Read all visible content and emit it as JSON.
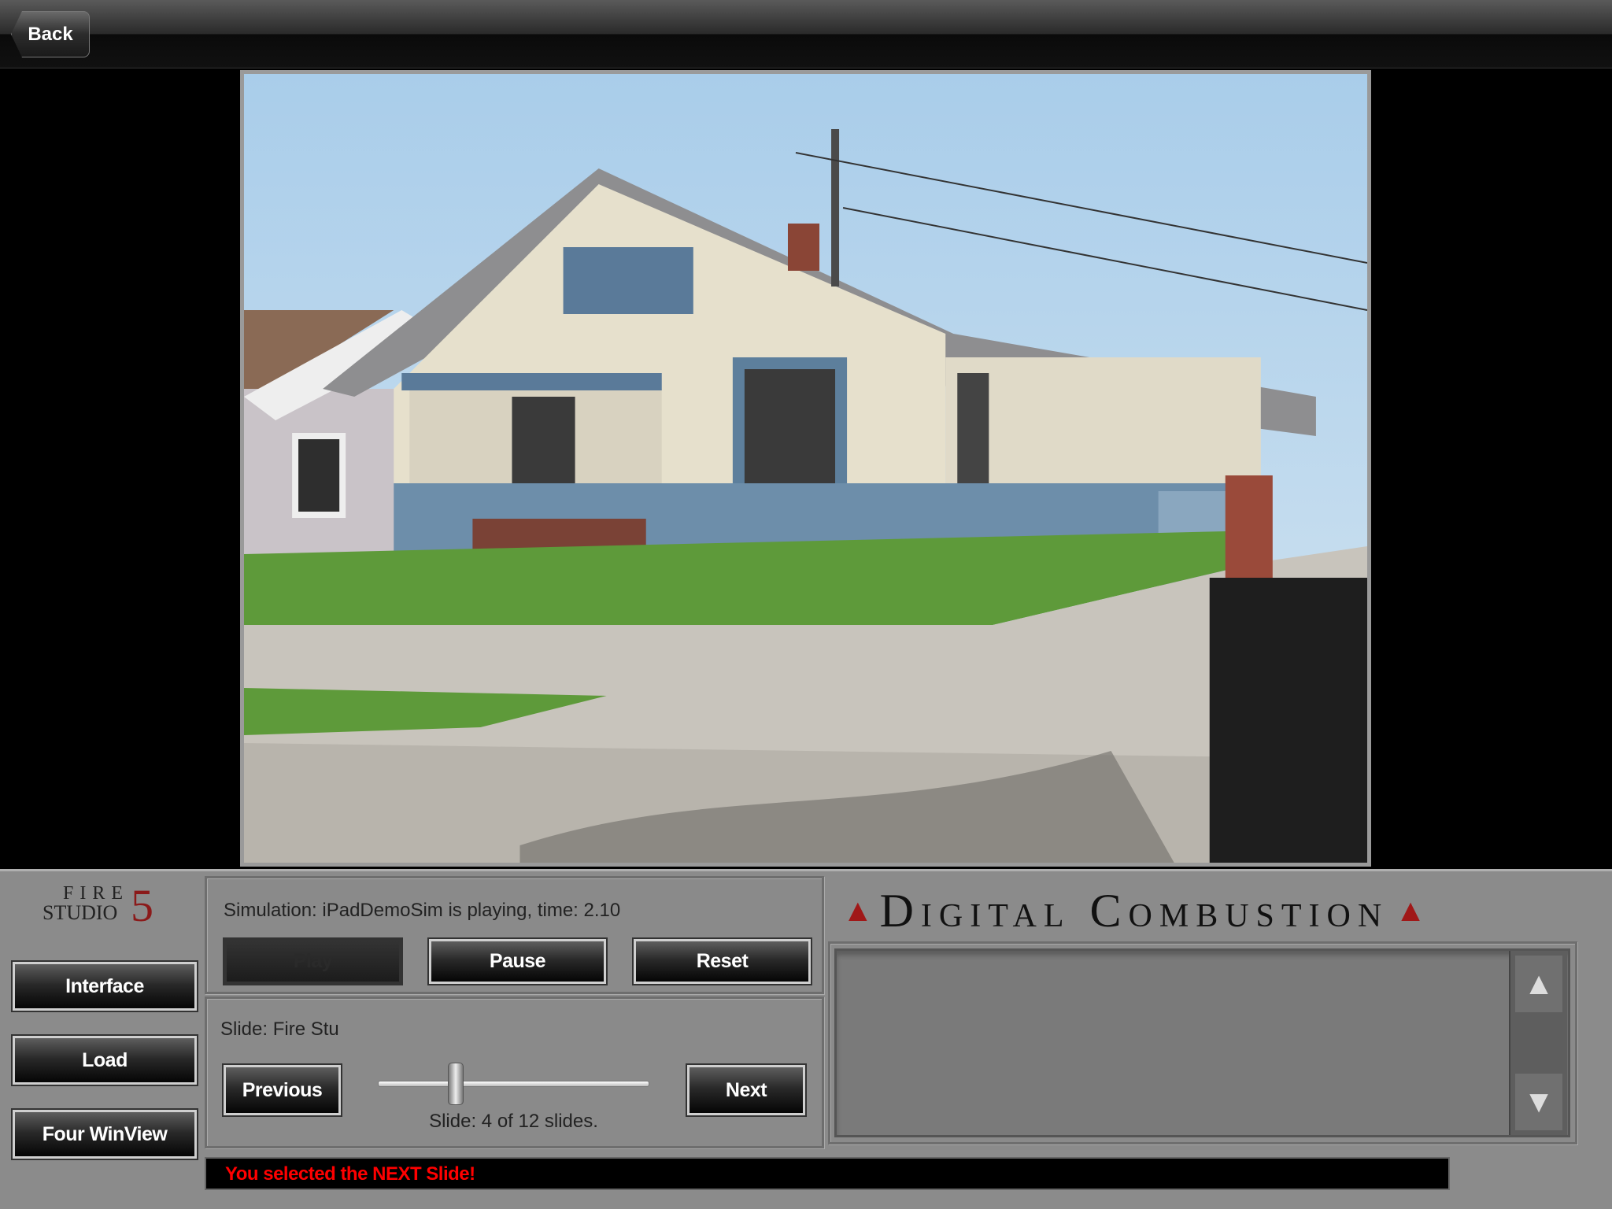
{
  "topbar": {
    "back_label": "Back"
  },
  "photo": {
    "description_alt": ""
  },
  "logo": {
    "fire_studio_line1": "FIRE",
    "fire_studio_line2": "STUDIO",
    "fire_studio_number": "5",
    "brand_color": "#8b1a1a"
  },
  "left_nav": {
    "items": [
      {
        "label": "Interface"
      },
      {
        "label": "Load"
      },
      {
        "label": "Four WinView"
      }
    ]
  },
  "simulation": {
    "status_text": "Simulation: iPadDemoSim is playing, time: 2.10",
    "play_label": "Play",
    "play_enabled": false,
    "pause_label": "Pause",
    "reset_label": "Reset"
  },
  "slides": {
    "slide_name": "Slide: Fire Stu",
    "previous_label": "Previous",
    "next_label": "Next",
    "counter_text": "Slide: 4 of 12 slides.",
    "current": 4,
    "total": 12
  },
  "status_bar": {
    "message": "You selected the NEXT Slide!",
    "color": "#ff0000"
  },
  "brand": {
    "title": "Digital Combustion"
  },
  "list": {
    "items": [],
    "scroll_up": "up-arrow",
    "scroll_down": "down-arrow"
  }
}
